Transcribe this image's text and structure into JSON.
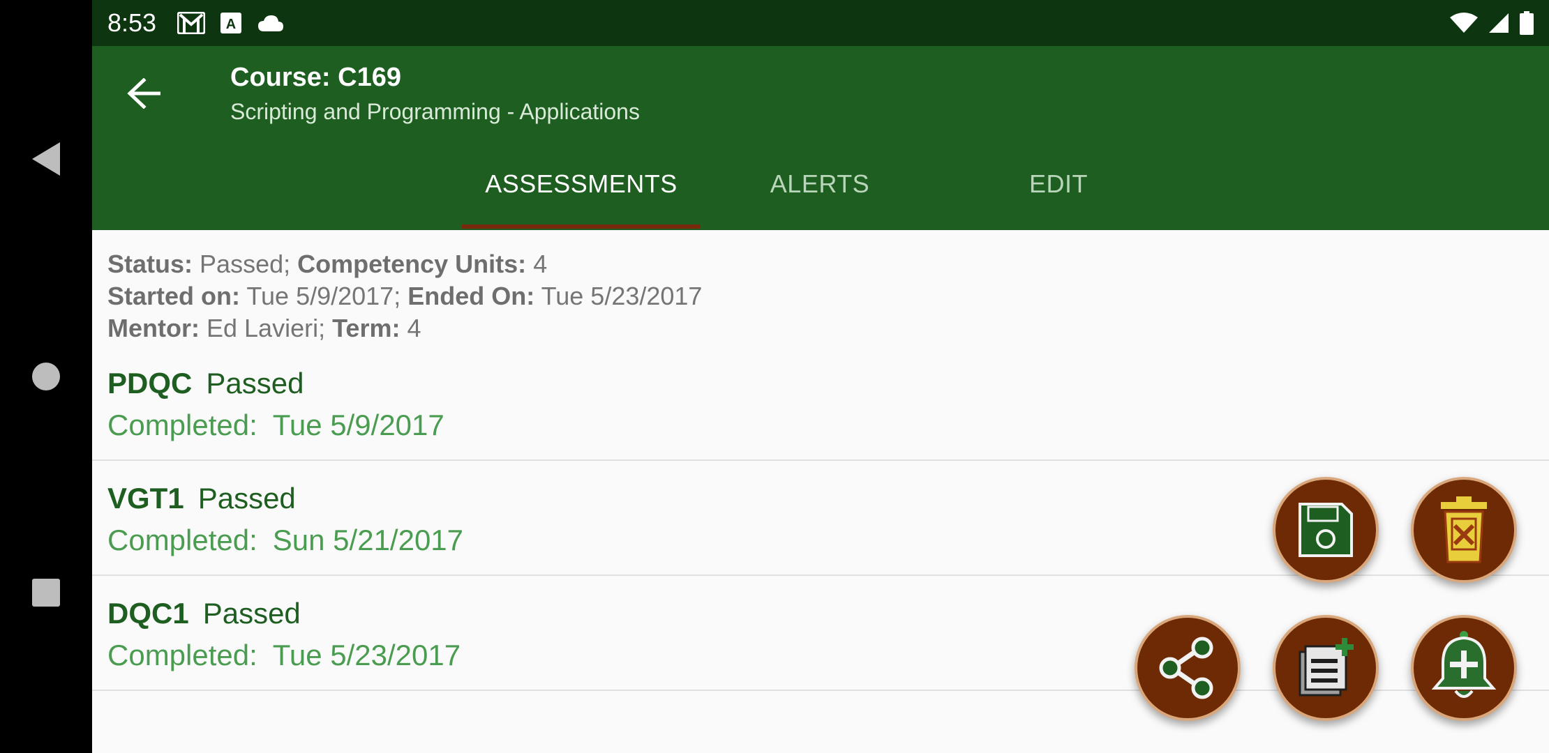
{
  "status_bar": {
    "time": "8:53",
    "icons_left": [
      "gmail-icon",
      "a-box-icon",
      "cloud-icon"
    ],
    "icons_right": [
      "wifi-icon",
      "signal-icon",
      "battery-icon"
    ]
  },
  "app_bar": {
    "title": "Course: C169",
    "subtitle": "Scripting and Programming - Applications"
  },
  "tabs": [
    {
      "label": "ASSESSMENTS",
      "selected": true
    },
    {
      "label": "ALERTS",
      "selected": false
    },
    {
      "label": "EDIT",
      "selected": false
    }
  ],
  "summary": {
    "status_label": "Status:",
    "status_value": "Passed;",
    "cu_label": "Competency Units:",
    "cu_value": "4",
    "started_label": "Started on:",
    "started_value": "Tue 5/9/2017;",
    "ended_label": "Ended On:",
    "ended_value": "Tue 5/23/2017",
    "mentor_label": "Mentor:",
    "mentor_value": "Ed Lavieri;",
    "term_label": "Term:",
    "term_value": "4"
  },
  "assessments": [
    {
      "code": "PDQC",
      "status": "Passed",
      "completed_label": "Completed:",
      "date": "Tue 5/9/2017"
    },
    {
      "code": "VGT1",
      "status": "Passed",
      "completed_label": "Completed:",
      "date": "Sun 5/21/2017"
    },
    {
      "code": "DQC1",
      "status": "Passed",
      "completed_label": "Completed:",
      "date": "Tue 5/23/2017"
    }
  ],
  "fabs": [
    "save-icon",
    "delete-icon",
    "share-icon",
    "add-note-icon",
    "add-alert-icon"
  ],
  "colors": {
    "primary": "#1e5e21",
    "primary_dark": "#0d3510",
    "accent": "#6d2a05",
    "item_title": "#1e5e21",
    "item_date": "#4a9c50"
  }
}
